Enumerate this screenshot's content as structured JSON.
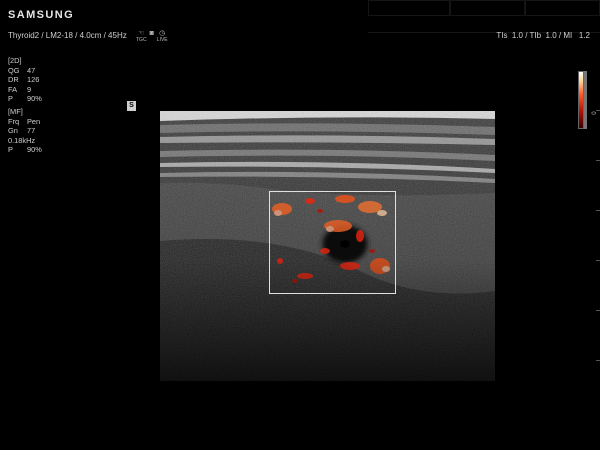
{
  "header": {
    "brand": "SAMSUNG",
    "probe_line": "Thyroid2 / LM2-18 / 4.0cm / 45Hz",
    "icons": [
      {
        "icon": "touch-icon",
        "glyph": "☜",
        "label": "TGC"
      },
      {
        "icon": "camera-icon",
        "glyph": "◙",
        "label": ""
      },
      {
        "icon": "live-icon",
        "glyph": "◷",
        "label": "LIVE"
      }
    ],
    "indices": "TIs  1.0 / TIb  1.0 / MI   1.2"
  },
  "params_2d": {
    "title": "[2D]",
    "rows": [
      {
        "k": "QG",
        "v": "47"
      },
      {
        "k": "DR",
        "v": "126"
      },
      {
        "k": "FA",
        "v": "9"
      },
      {
        "k": "P",
        "v": "90%"
      }
    ]
  },
  "params_mf": {
    "title": "[MF]",
    "rows": [
      {
        "k": "Frq",
        "v": "Pen"
      },
      {
        "k": "Gn",
        "v": "77"
      }
    ],
    "freq": "0.18kHz",
    "power": {
      "k": "P",
      "v": "90%"
    }
  },
  "markers": {
    "orientation": "S"
  },
  "colorbar": {
    "zero_label": "0",
    "colors": [
      "#ffffff",
      "#ffd9a0",
      "#ff5a2a",
      "#b1120b",
      "#3a0000"
    ]
  }
}
